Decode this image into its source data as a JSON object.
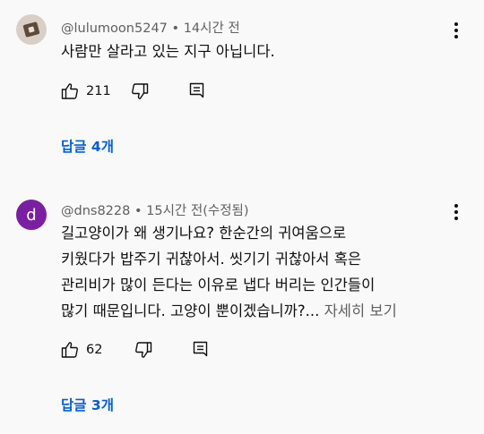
{
  "comments": [
    {
      "author": "@lulumoon5247",
      "separator": "•",
      "time": "14시간 전",
      "lines": [
        "사람만 살라고 있는 지구 아닙니다."
      ],
      "read_more": "",
      "likes": "211",
      "replies_label": "답글 4개"
    },
    {
      "author": "@dns8228",
      "separator": "•",
      "time": "15시간 전(수정됨)",
      "avatar_letter": "d",
      "avatar_color": "#7b1fa2",
      "lines": [
        "길고양이가 왜 생기나요?  한순간의 귀여움으로",
        "키웠다가 밥주기 귀찮아서. 씻기기 귀찮아서 혹은",
        "관리비가 많이 든다는 이유로 냅다 버리는 인간들이",
        "많기 때문입니다. 고양이 뿐이겠습니까?..."
      ],
      "read_more": "자세히 보기",
      "likes": "62",
      "replies_label": "답글 3개"
    }
  ],
  "colors": {
    "background": "#f9f9f9",
    "link_blue": "#065fd4",
    "secondary_text": "#606060"
  },
  "icons": [
    "thumbs-up-icon",
    "thumbs-down-icon",
    "reply-icon",
    "more-vert-icon"
  ]
}
